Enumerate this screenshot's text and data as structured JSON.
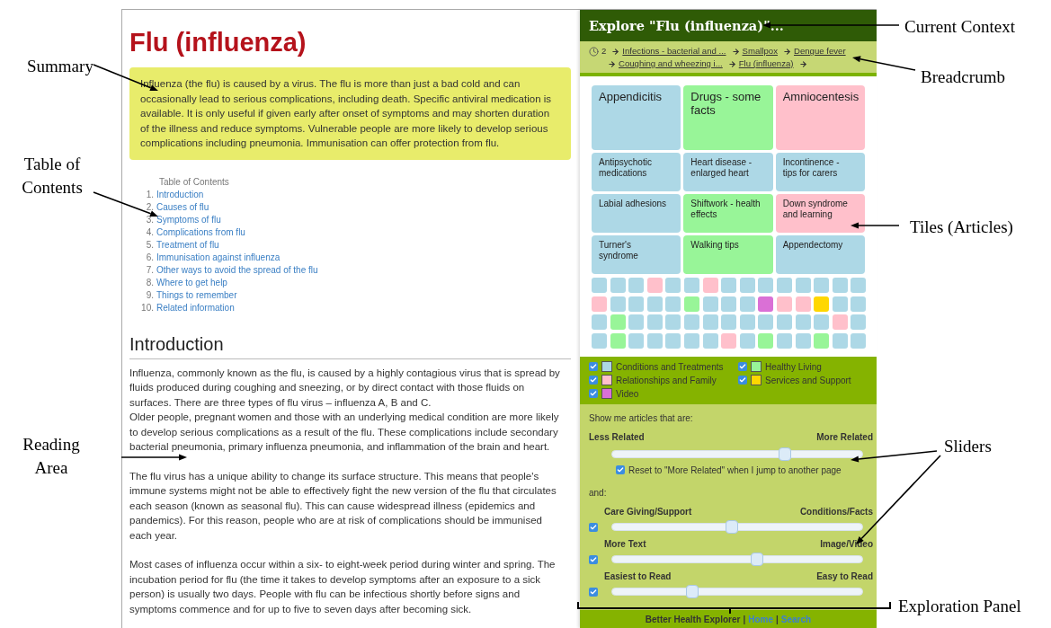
{
  "article": {
    "title": "Flu (influenza)",
    "summary": "Influenza (the flu) is caused by a virus. The flu is more than just a bad cold and can occasionally lead to serious complications, including death. Specific antiviral medication is available. It is only useful if given early after onset of symptoms and may shorten duration of the illness and reduce symptoms. Vulnerable people are more likely to develop serious complications including pneumonia. Immunisation can offer protection from flu.",
    "toc": {
      "heading": "Table of Contents",
      "items": [
        {
          "number": "1.",
          "label": "Introduction"
        },
        {
          "number": "2.",
          "label": "Causes of flu"
        },
        {
          "number": "3.",
          "label": "Symptoms of flu"
        },
        {
          "number": "4.",
          "label": "Complications from flu"
        },
        {
          "number": "5.",
          "label": "Treatment of flu"
        },
        {
          "number": "6.",
          "label": "Immunisation against influenza"
        },
        {
          "number": "7.",
          "label": "Other ways to avoid the spread of the flu"
        },
        {
          "number": "8.",
          "label": "Where to get help"
        },
        {
          "number": "9.",
          "label": "Things to remember"
        },
        {
          "number": "10.",
          "label": "Related information"
        }
      ]
    },
    "section_heading": "Introduction",
    "blocks": [
      {
        "paragraphs": [
          "Influenza, commonly known as the flu, is caused by a highly contagious virus that is spread by fluids produced during coughing and sneezing, or by direct contact with those fluids on surfaces. There are three types of flu virus – influenza A, B and C.",
          "Older people, pregnant women and those with an underlying medical condition are more likely to develop serious complications as a result of the flu. These complications include secondary bacterial pneumonia, primary influenza pneumonia, and inflammation of the brain and heart."
        ]
      },
      {
        "paragraphs": [
          "The flu virus has a unique ability to change its surface structure. This means that people's immune systems might not be able to effectively fight the new version of the flu that circulates each season (known as seasonal flu). This can cause widespread illness (epidemics and pandemics). For this reason, people who are at risk of complications should be immunised each year."
        ]
      },
      {
        "paragraphs": [
          "Most cases of influenza occur within a six- to eight-week period during winter and spring. The incubation period for flu (the time it takes to develop symptoms after an exposure to a sick person) is usually two days. People with flu can be infectious shortly before signs and symptoms commence and for up to five to seven days after becoming sick."
        ]
      }
    ]
  },
  "explorer": {
    "title": "Explore \"Flu (influenza)\"...",
    "history_count": "2",
    "crumbs": [
      "Infections - bacterial and ...",
      "Smallpox",
      "Dengue fever",
      "Coughing and wheezing i...",
      "Flu (influenza)"
    ],
    "tile_rows": [
      {
        "kind": "large",
        "tiles": [
          {
            "label": "Appendicitis",
            "color": "#add8e6"
          },
          {
            "label": "Drugs - some facts",
            "color": "#98f598"
          },
          {
            "label": "Amniocentesis",
            "color": "#ffc0cb"
          }
        ]
      },
      {
        "kind": "medium",
        "tiles": [
          {
            "label": "Antipsychotic medications",
            "color": "#add8e6"
          },
          {
            "label": "Heart disease - enlarged heart",
            "color": "#add8e6"
          },
          {
            "label": "Incontinence - tips for carers",
            "color": "#add8e6"
          }
        ]
      },
      {
        "kind": "medium",
        "tiles": [
          {
            "label": "Labial adhesions",
            "color": "#add8e6"
          },
          {
            "label": "Shiftwork - health effects",
            "color": "#98f598"
          },
          {
            "label": "Down syndrome and learning",
            "color": "#ffc0cb"
          }
        ]
      },
      {
        "kind": "medium",
        "tiles": [
          {
            "label": "Turner's syndrome",
            "color": "#add8e6"
          },
          {
            "label": "Walking tips",
            "color": "#98f598"
          },
          {
            "label": "Appendectomy",
            "color": "#add8e6"
          }
        ]
      }
    ],
    "mini_tiles": [
      {
        "color": "#add8e6"
      },
      {
        "color": "#add8e6"
      },
      {
        "color": "#add8e6"
      },
      {
        "color": "#ffc0cb"
      },
      {
        "color": "#add8e6"
      },
      {
        "color": "#add8e6"
      },
      {
        "color": "#ffc0cb"
      },
      {
        "color": "#add8e6"
      },
      {
        "color": "#add8e6"
      },
      {
        "color": "#add8e6"
      },
      {
        "color": "#add8e6"
      },
      {
        "color": "#add8e6"
      },
      {
        "color": "#add8e6"
      },
      {
        "color": "#add8e6"
      },
      {
        "color": "#add8e6"
      },
      {
        "color": "#ffc0cb"
      },
      {
        "color": "#add8e6"
      },
      {
        "color": "#add8e6"
      },
      {
        "color": "#add8e6"
      },
      {
        "color": "#add8e6"
      },
      {
        "color": "#98f598"
      },
      {
        "color": "#add8e6"
      },
      {
        "color": "#add8e6"
      },
      {
        "color": "#add8e6"
      },
      {
        "color": "#da70d6"
      },
      {
        "color": "#ffc0cb"
      },
      {
        "color": "#ffc0cb"
      },
      {
        "color": "#ffd700"
      },
      {
        "color": "#add8e6"
      },
      {
        "color": "#add8e6"
      },
      {
        "color": "#add8e6"
      },
      {
        "color": "#98f598"
      },
      {
        "color": "#add8e6"
      },
      {
        "color": "#add8e6"
      },
      {
        "color": "#add8e6"
      },
      {
        "color": "#add8e6"
      },
      {
        "color": "#add8e6"
      },
      {
        "color": "#add8e6"
      },
      {
        "color": "#add8e6"
      },
      {
        "color": "#add8e6"
      },
      {
        "color": "#add8e6"
      },
      {
        "color": "#add8e6"
      },
      {
        "color": "#add8e6"
      },
      {
        "color": "#ffc0cb"
      },
      {
        "color": "#add8e6"
      },
      {
        "color": "#add8e6"
      },
      {
        "color": "#98f598"
      },
      {
        "color": "#add8e6"
      },
      {
        "color": "#add8e6"
      },
      {
        "color": "#add8e6"
      },
      {
        "color": "#add8e6"
      },
      {
        "color": "#add8e6"
      },
      {
        "color": "#ffc0cb"
      },
      {
        "color": "#add8e6"
      },
      {
        "color": "#98f598"
      },
      {
        "color": "#add8e6"
      },
      {
        "color": "#add8e6"
      },
      {
        "color": "#98f598"
      },
      {
        "color": "#add8e6"
      },
      {
        "color": "#add8e6"
      }
    ],
    "categories": [
      {
        "label": "Conditions and Treatments",
        "color": "#add8e6",
        "checked": true
      },
      {
        "label": "Healthy Living",
        "color": "#98f598",
        "checked": true
      },
      {
        "label": "Relationships and Family",
        "color": "#ffc0cb",
        "checked": true
      },
      {
        "label": "Services and Support",
        "color": "#ffd700",
        "checked": true
      },
      {
        "label": "Video",
        "color": "#da70d6",
        "checked": true
      }
    ],
    "relatedness": {
      "intro": "Show me articles that are:",
      "left": "Less Related",
      "right": "More Related",
      "level": 0.69,
      "reset": {
        "label": "Reset to \"More Related\" when I jump to another page",
        "checked": true
      }
    },
    "and_label": "and:",
    "facet_sliders": [
      {
        "left": "Care Giving/Support",
        "right": "Conditions/Facts",
        "checked": true,
        "level": 0.48
      },
      {
        "left": "More Text",
        "right": "Image/Video",
        "checked": true,
        "level": 0.58
      },
      {
        "left": "Easiest to Read",
        "right": "Easy to Read",
        "checked": true,
        "level": 0.32
      }
    ],
    "footer": [
      {
        "kind": "text",
        "text": "Better Health Explorer"
      },
      {
        "kind": "separator",
        "text": "|"
      },
      {
        "kind": "link",
        "text": "Home"
      },
      {
        "kind": "separator",
        "text": "|"
      },
      {
        "kind": "link",
        "text": "Search"
      }
    ]
  },
  "annotations": [
    {
      "text": "Summary"
    },
    {
      "text": "Table of Contents"
    },
    {
      "text": "Reading Area"
    },
    {
      "text": "Current Context"
    },
    {
      "text": "Breadcrumb"
    },
    {
      "text": "Tiles (Articles)"
    },
    {
      "text": "Sliders"
    },
    {
      "text": "Exploration Panel"
    }
  ]
}
